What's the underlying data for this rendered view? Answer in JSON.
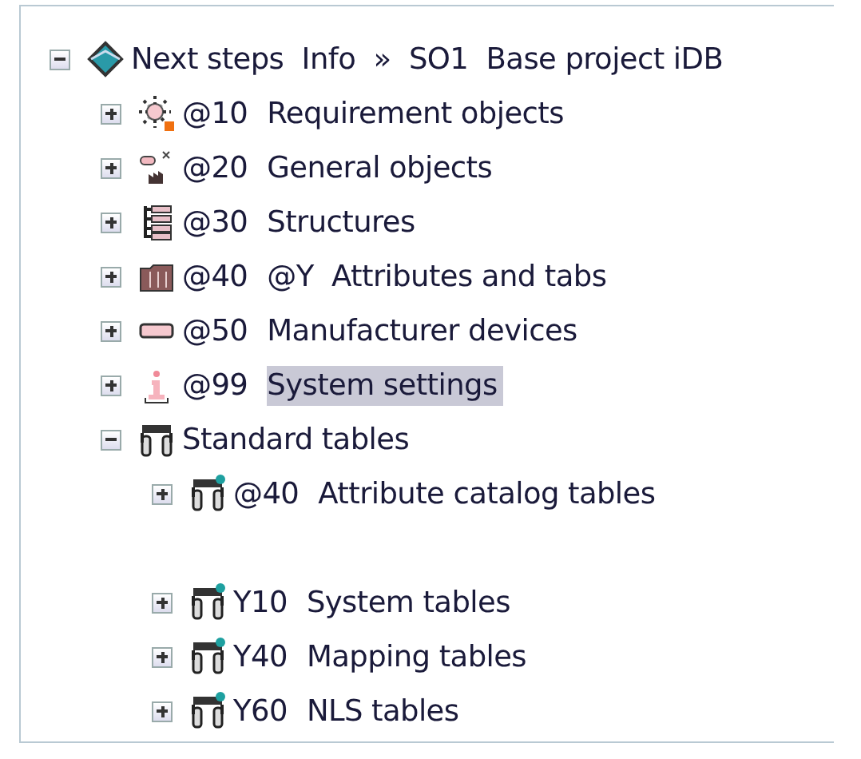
{
  "tree": {
    "label": "Next steps  Info  »  SO1  Base project iDB",
    "kind": "diamond",
    "expanded": true,
    "selected": false,
    "children": [
      {
        "code": "@10",
        "label": "Requirement objects",
        "kind": "requirement",
        "expanded": false,
        "selected": false
      },
      {
        "code": "@20",
        "label": "General objects",
        "kind": "objects",
        "expanded": false,
        "selected": false
      },
      {
        "code": "@30",
        "label": "Structures",
        "kind": "structure",
        "expanded": false,
        "selected": false
      },
      {
        "code": "@40",
        "label": "@Y  Attributes and tabs",
        "kind": "folder",
        "expanded": false,
        "selected": false
      },
      {
        "code": "@50",
        "label": "Manufacturer devices",
        "kind": "device",
        "expanded": false,
        "selected": false
      },
      {
        "code": "@99",
        "label": "System settings",
        "kind": "system",
        "expanded": false,
        "selected": true
      },
      {
        "label": "Standard tables",
        "kind": "table",
        "expanded": true,
        "selected": false,
        "children": [
          {
            "code": "@40",
            "label": "Attribute catalog tables",
            "kind": "table-dot",
            "expanded": false,
            "selected": false,
            "spaced_after": true
          },
          {
            "code": "Y10",
            "label": "System tables",
            "kind": "table-dot",
            "expanded": false,
            "selected": false
          },
          {
            "code": "Y40",
            "label": "Mapping tables",
            "kind": "table-dot",
            "expanded": false,
            "selected": false
          },
          {
            "code": "Y60",
            "label": "NLS tables",
            "kind": "table-dot",
            "expanded": false,
            "selected": false
          }
        ]
      }
    ]
  }
}
